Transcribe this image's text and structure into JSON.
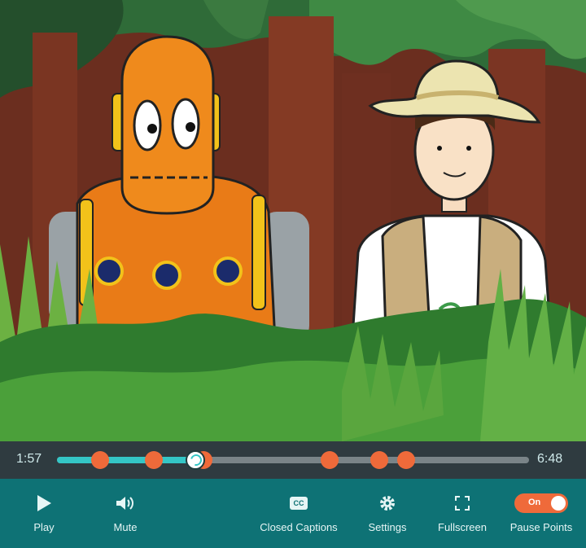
{
  "video": {
    "scene": "jungle-cartoon-robot-and-explorer"
  },
  "seekbar": {
    "current_time": "1:57",
    "duration": "6:48",
    "progress_fraction": 0.293,
    "pause_points": [
      0.091,
      0.205,
      0.31,
      0.578,
      0.682,
      0.74
    ]
  },
  "controls": {
    "play_label": "Play",
    "mute_label": "Mute",
    "cc_label": "Closed Captions",
    "cc_icon_text": "CC",
    "settings_label": "Settings",
    "fullscreen_label": "Fullscreen",
    "pause_points_label": "Pause Points",
    "pause_points_toggle": "On"
  },
  "colors": {
    "accent_orange": "#ef6a3a",
    "progress_teal": "#34c6c6",
    "controls_bg": "#0e7275",
    "seekbar_bg": "#2f3b40"
  }
}
